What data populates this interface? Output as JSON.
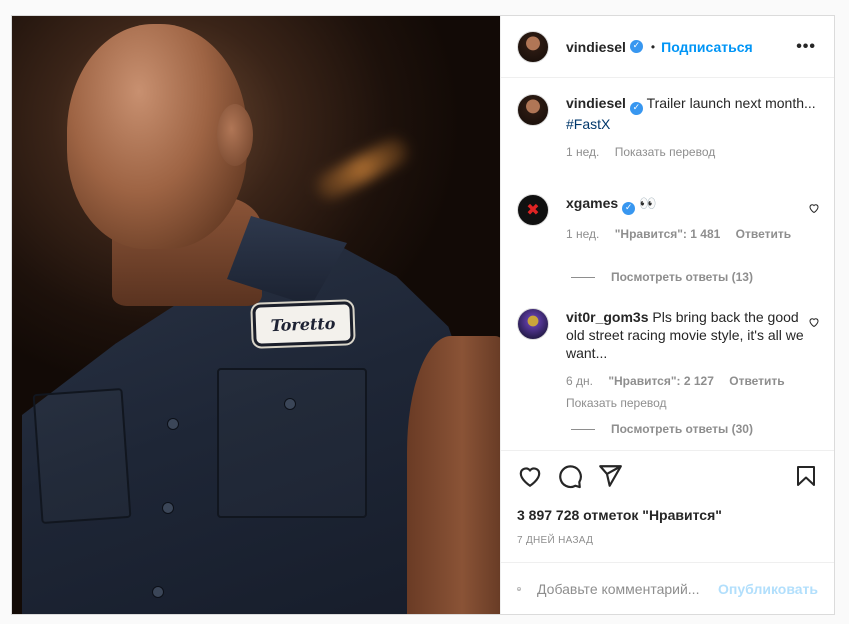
{
  "photo": {
    "patch_text": "Toretto"
  },
  "header": {
    "username": "vindiesel",
    "verified_mark": "✓",
    "separator": "•",
    "follow_label": "Подписаться",
    "more_label": "•••"
  },
  "caption": {
    "username": "vindiesel",
    "text": "Trailer launch next month...",
    "hashtag": "#FastX",
    "time": "1 нед.",
    "translate_label": "Показать перевод"
  },
  "comments": [
    {
      "username": "xgames",
      "text": "👀",
      "time": "1 нед.",
      "likes": "\"Нравится\": 1 481",
      "reply_label": "Ответить",
      "view_replies": "Посмотреть ответы (13)",
      "avatar_mark": "✖"
    },
    {
      "username": "vit0r_gom3s",
      "text": "Pls bring back the good old street racing movie style, it's all we want...",
      "time": "6 дн.",
      "likes": "\"Нравится\": 2 127",
      "reply_label": "Ответить",
      "translate_label": "Показать перевод",
      "view_replies": "Посмотреть ответы (30)"
    }
  ],
  "actions": {
    "likes_count": "3 897 728 отметок \"Нравится\"",
    "date": "7 ДНЕЙ НАЗАД"
  },
  "add_comment": {
    "placeholder": "Добавьте комментарий...",
    "publish_label": "Опубликовать"
  },
  "icons": {
    "like": "heart-icon",
    "comment": "comment-icon",
    "share": "paper-plane-icon",
    "save": "bookmark-icon",
    "emoji": "smiley-icon",
    "more": "more-dots-icon"
  }
}
